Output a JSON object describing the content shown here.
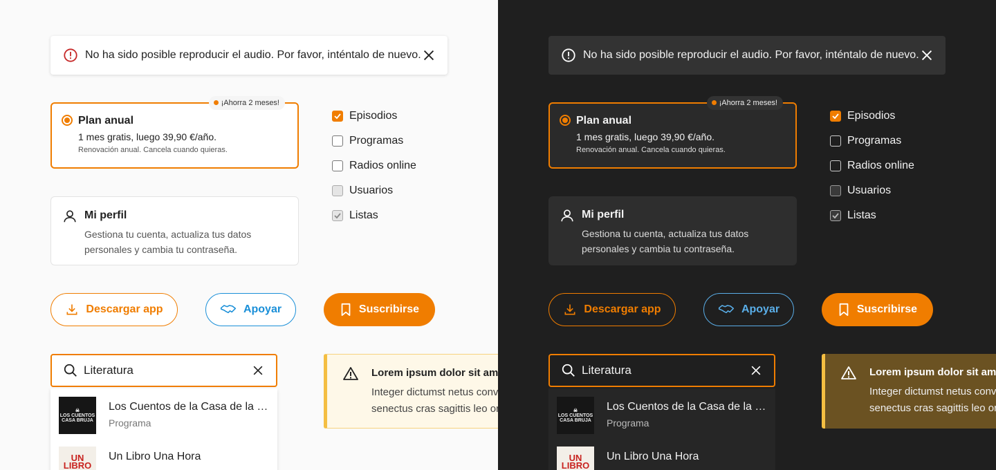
{
  "toast": {
    "message": "No ha sido posible reproducir el audio. Por favor, inténtalo de nuevo."
  },
  "plan": {
    "badge": "¡Ahorra 2 meses!",
    "title": "Plan anual",
    "line1": "1 mes gratis, luego 39,90 €/año.",
    "line2": "Renovación anual. Cancela cuando quieras."
  },
  "profile": {
    "title": "Mi perfil",
    "description": "Gestiona tu cuenta, actualiza tus datos personales y cambia tu contraseña."
  },
  "checkboxes": [
    {
      "label": "Episodios",
      "state": "checked"
    },
    {
      "label": "Programas",
      "state": "unchecked"
    },
    {
      "label": "Radios online",
      "state": "unchecked"
    },
    {
      "label": "Usuarios",
      "state": "disabled"
    },
    {
      "label": "Listas",
      "state": "disabled-checked"
    }
  ],
  "buttons": {
    "download": "Descargar app",
    "support": "Apoyar",
    "subscribe": "Suscribirse"
  },
  "search": {
    "value": "Literatura",
    "results": [
      {
        "name": "Los Cuentos de la Casa de la Bruja",
        "type": "Programa",
        "thumb_text": "LOS CUENTOS CASA BRUJA"
      },
      {
        "name": "Un Libro Una Hora",
        "type": "",
        "thumb_text": "UN LIBRO UNA HORA"
      }
    ]
  },
  "alert": {
    "title": "Lorem ipsum dolor sit amet",
    "body_line1": "Integer dictumst netus convallis",
    "body_line2": "senectus cras sagittis leo orci"
  },
  "colors": {
    "accent": "#f07d00",
    "support": "#1a8fd8",
    "warning": "#f4be42",
    "error": "#c62828"
  }
}
